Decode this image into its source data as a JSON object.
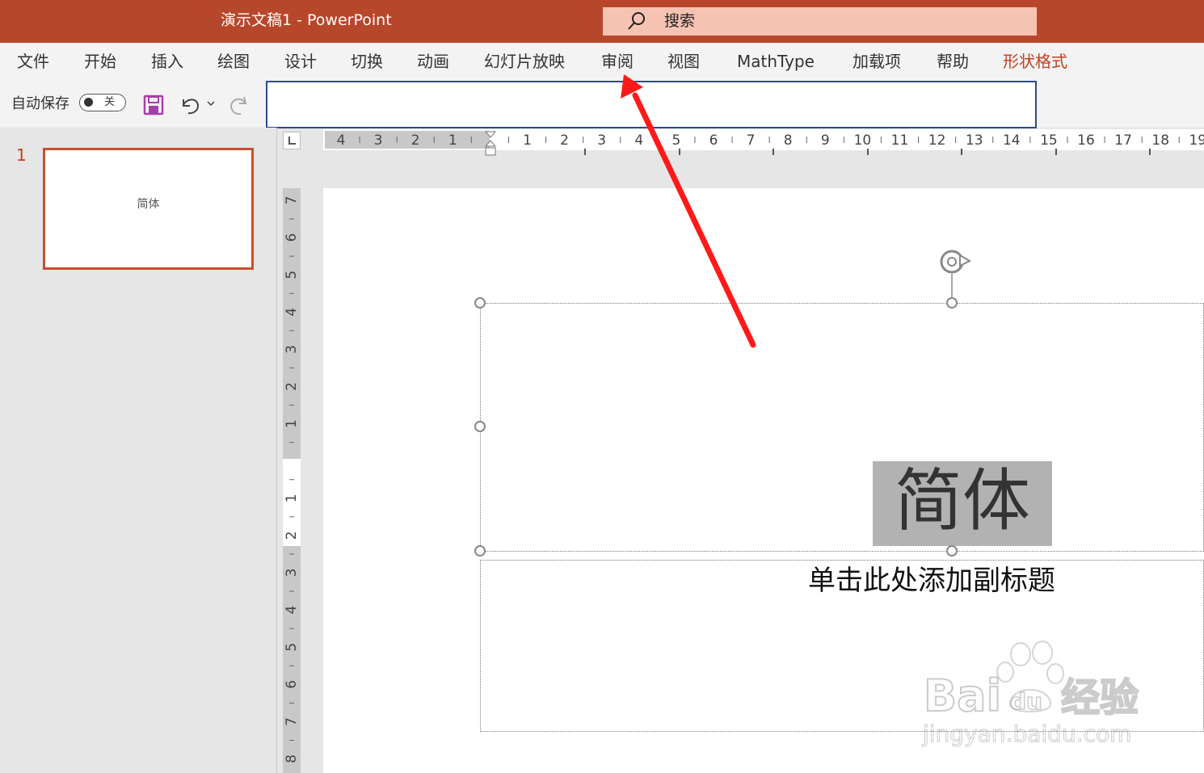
{
  "title_bar": {
    "title": "演示文稿1  -  PowerPoint",
    "color": "#b7472a"
  },
  "search": {
    "label": "搜索",
    "icon": "search-icon"
  },
  "menu": {
    "items": [
      "文件",
      "开始",
      "插入",
      "绘图",
      "设计",
      "切换",
      "动画",
      "幻灯片放映",
      "审阅",
      "视图",
      "MathType",
      "加载项",
      "帮助",
      "形状格式"
    ],
    "accent_item": "形状格式",
    "accent_color": "#c43e1c"
  },
  "quick_access": {
    "autosave_label": "自动保存",
    "toggle_state": "关",
    "icons": [
      "save-icon",
      "undo-icon",
      "undo-dropdown-icon",
      "redo-icon"
    ]
  },
  "horizontal_ruler": {
    "labels": [
      "4",
      "3",
      "2",
      "1",
      "1",
      "2",
      "3",
      "4",
      "5",
      "6",
      "7",
      "8",
      "9",
      "10",
      "11",
      "12",
      "13",
      "14",
      "15",
      "16",
      "17",
      "18",
      "19"
    ]
  },
  "vertical_ruler": {
    "labels": [
      "7",
      "6",
      "5",
      "4",
      "3",
      "2",
      "1",
      "1",
      "2",
      "3",
      "4",
      "5",
      "6",
      "7",
      "8"
    ]
  },
  "slides_panel": {
    "slide_number": "1",
    "thumbnail_text": "简体"
  },
  "slide": {
    "title": "简体",
    "subtitle": "单击此处添加副标题"
  },
  "annotation": {
    "type": "red-arrow",
    "points_to": "审阅",
    "color": "#ff1a1a"
  },
  "watermark": {
    "logo_text": "Bai 经验",
    "url": "jingyan.baidu.com"
  }
}
